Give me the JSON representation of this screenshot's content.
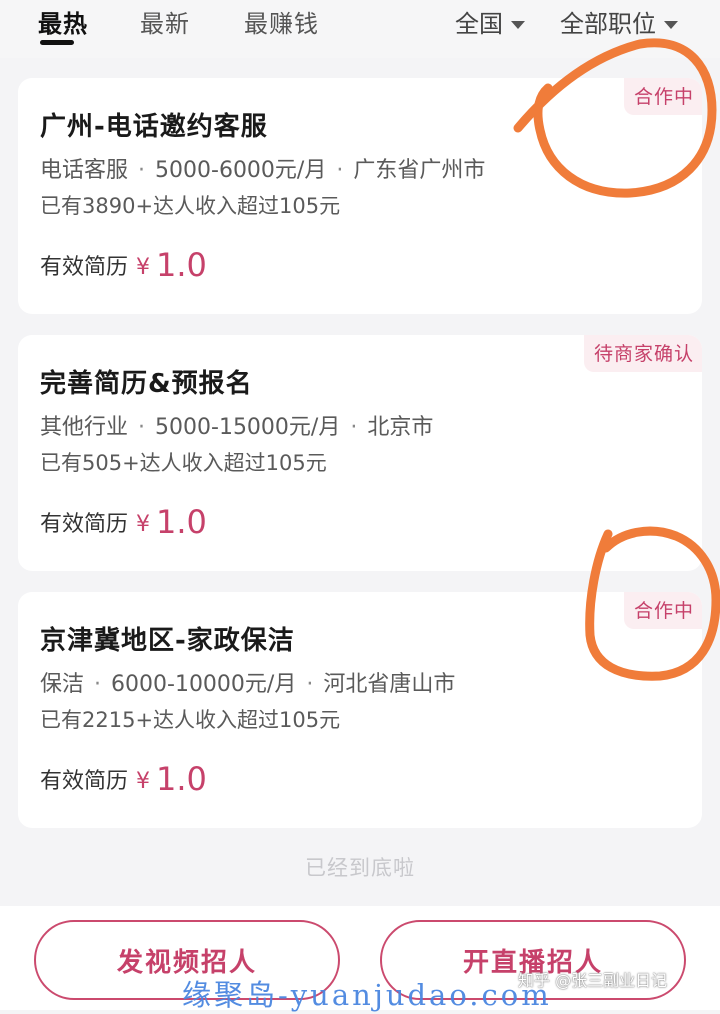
{
  "tabs": [
    {
      "label": "最热",
      "active": true
    },
    {
      "label": "最新",
      "active": false
    },
    {
      "label": "最赚钱",
      "active": false
    }
  ],
  "filters": {
    "region": "全国",
    "position": "全部职位"
  },
  "jobs": [
    {
      "title": "广州-电话邀约客服",
      "badge": "合作中",
      "category": "电话客服",
      "salary": "5000-6000元/月",
      "location": "广东省广州市",
      "earn_note": "已有3890+达人收入超过105元",
      "price_label": "有效简历",
      "currency": "¥",
      "price": "1.0"
    },
    {
      "title": "完善简历&预报名",
      "badge": "待商家确认",
      "category": "其他行业",
      "salary": "5000-15000元/月",
      "location": "北京市",
      "earn_note": "已有505+达人收入超过105元",
      "price_label": "有效简历",
      "currency": "¥",
      "price": "1.0"
    },
    {
      "title": "京津冀地区-家政保洁",
      "badge": "合作中",
      "category": "保洁",
      "salary": "6000-10000元/月",
      "location": "河北省唐山市",
      "earn_note": "已有2215+达人收入超过105元",
      "price_label": "有效简历",
      "currency": "¥",
      "price": "1.0"
    }
  ],
  "end_note": "已经到底啦",
  "bottom": {
    "video_button": "发视频招人",
    "live_button": "开直播招人"
  },
  "overlays": {
    "watermark": "缘聚岛-yuanjudao.com",
    "zhihu_mark": "知乎 @张三副业日记"
  },
  "colors": {
    "accent": "#c6416a",
    "annotation": "#f07c3a",
    "watermark": "#4a86e0"
  },
  "separator": "·"
}
